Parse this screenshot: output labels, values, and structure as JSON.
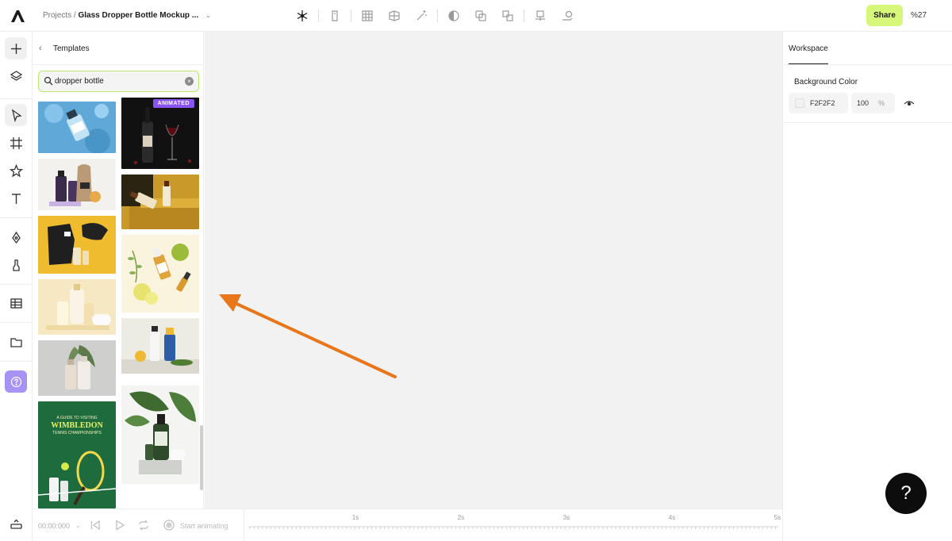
{
  "header": {
    "projects_label": "Projects /",
    "project_name": "Glass Dropper Bottle Mockup ...",
    "share_label": "Share",
    "zoom_label": "%27"
  },
  "templates_panel": {
    "title": "Templates",
    "search_value": "dropper bottle",
    "animated_badge": "ANIMATED"
  },
  "workspace": {
    "tab_label": "Workspace",
    "background_label": "Background Color",
    "color_hex": "F2F2F2",
    "opacity_value": "100",
    "opacity_unit": "%"
  },
  "timeline": {
    "time_value": "00:00:000",
    "start_label": "Start animating",
    "ticks": [
      "1s",
      "2s",
      "3s",
      "4s",
      "5s"
    ]
  },
  "help_fab_label": "?",
  "colors": {
    "accent": "#d7f77a",
    "search_border": "#b9e86a",
    "badge": "#8a54f5",
    "help_button": "#a793f5",
    "arrow": "#e8761a",
    "canvas": "#f2f2f2"
  }
}
